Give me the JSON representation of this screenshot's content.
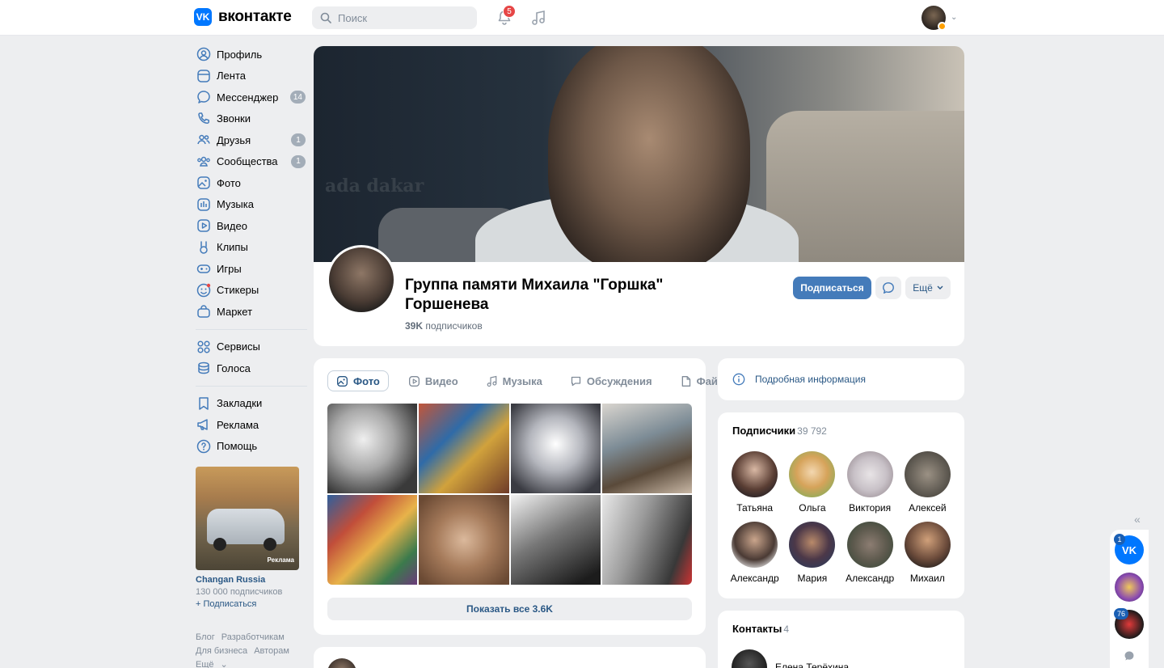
{
  "header": {
    "logo_mark": "VK",
    "logo_text": "вконтакте",
    "search_placeholder": "Поиск",
    "notifications_count": "5",
    "icons": [
      "search-icon",
      "bell-icon",
      "music-icon",
      "chevron-down-icon"
    ]
  },
  "sidebar": {
    "items": [
      {
        "label": "Профиль",
        "icon": "user-icon"
      },
      {
        "label": "Лента",
        "icon": "feed-icon"
      },
      {
        "label": "Мессенджер",
        "icon": "message-icon",
        "count": "14"
      },
      {
        "label": "Звонки",
        "icon": "phone-icon"
      },
      {
        "label": "Друзья",
        "icon": "friends-icon",
        "count": "1"
      },
      {
        "label": "Сообщества",
        "icon": "communities-icon",
        "count": "1"
      },
      {
        "label": "Фото",
        "icon": "photo-icon"
      },
      {
        "label": "Музыка",
        "icon": "music-icon"
      },
      {
        "label": "Видео",
        "icon": "video-icon"
      },
      {
        "label": "Клипы",
        "icon": "clips-icon"
      },
      {
        "label": "Игры",
        "icon": "gamepad-icon"
      },
      {
        "label": "Стикеры",
        "icon": "smile-icon"
      },
      {
        "label": "Маркет",
        "icon": "bag-icon"
      }
    ],
    "items2": [
      {
        "label": "Сервисы",
        "icon": "grid-icon"
      },
      {
        "label": "Голоса",
        "icon": "coins-icon"
      }
    ],
    "items3": [
      {
        "label": "Закладки",
        "icon": "bookmark-icon"
      },
      {
        "label": "Реклама",
        "icon": "megaphone-icon"
      },
      {
        "label": "Помощь",
        "icon": "help-icon"
      }
    ],
    "ad": {
      "badge": "Реклама",
      "name": "Changan Russia",
      "subscribers": "130 000 подписчиков",
      "subscribe": "+ Подписаться"
    },
    "footer": {
      "links": [
        "Блог",
        "Разработчикам",
        "Для бизнеса",
        "Авторам",
        "Ещё"
      ]
    }
  },
  "group": {
    "cover_watermark": "ada dakar",
    "title": "Группа памяти Михаила \"Горшка\" Горшенева",
    "subs_count": "39K",
    "subs_label": "подписчиков",
    "subscribe_button": "Подписаться",
    "more_button": "Ещё"
  },
  "media": {
    "tabs": [
      "Фото",
      "Видео",
      "Музыка",
      "Обсуждения",
      "Файлы"
    ],
    "active_tab": "Фото",
    "show_all": "Показать все 3.6K"
  },
  "info": {
    "label": "Подробная информация"
  },
  "subscribers": {
    "title": "Подписчики",
    "count": "39 792",
    "people": [
      "Татьяна",
      "Ольга",
      "Виктория",
      "Алексей",
      "Александр",
      "Мария",
      "Александр",
      "Михаил"
    ]
  },
  "contacts": {
    "title": "Контакты",
    "count": "4",
    "first_name": "Елена Терёхина"
  },
  "dock": {
    "vk_badge": "1",
    "second_badge": "76"
  },
  "colors": {
    "accent": "#447bba",
    "link": "#2a5885",
    "background": "#edeef0",
    "badge_red": "#e64646",
    "vk_blue": "#0077ff"
  }
}
